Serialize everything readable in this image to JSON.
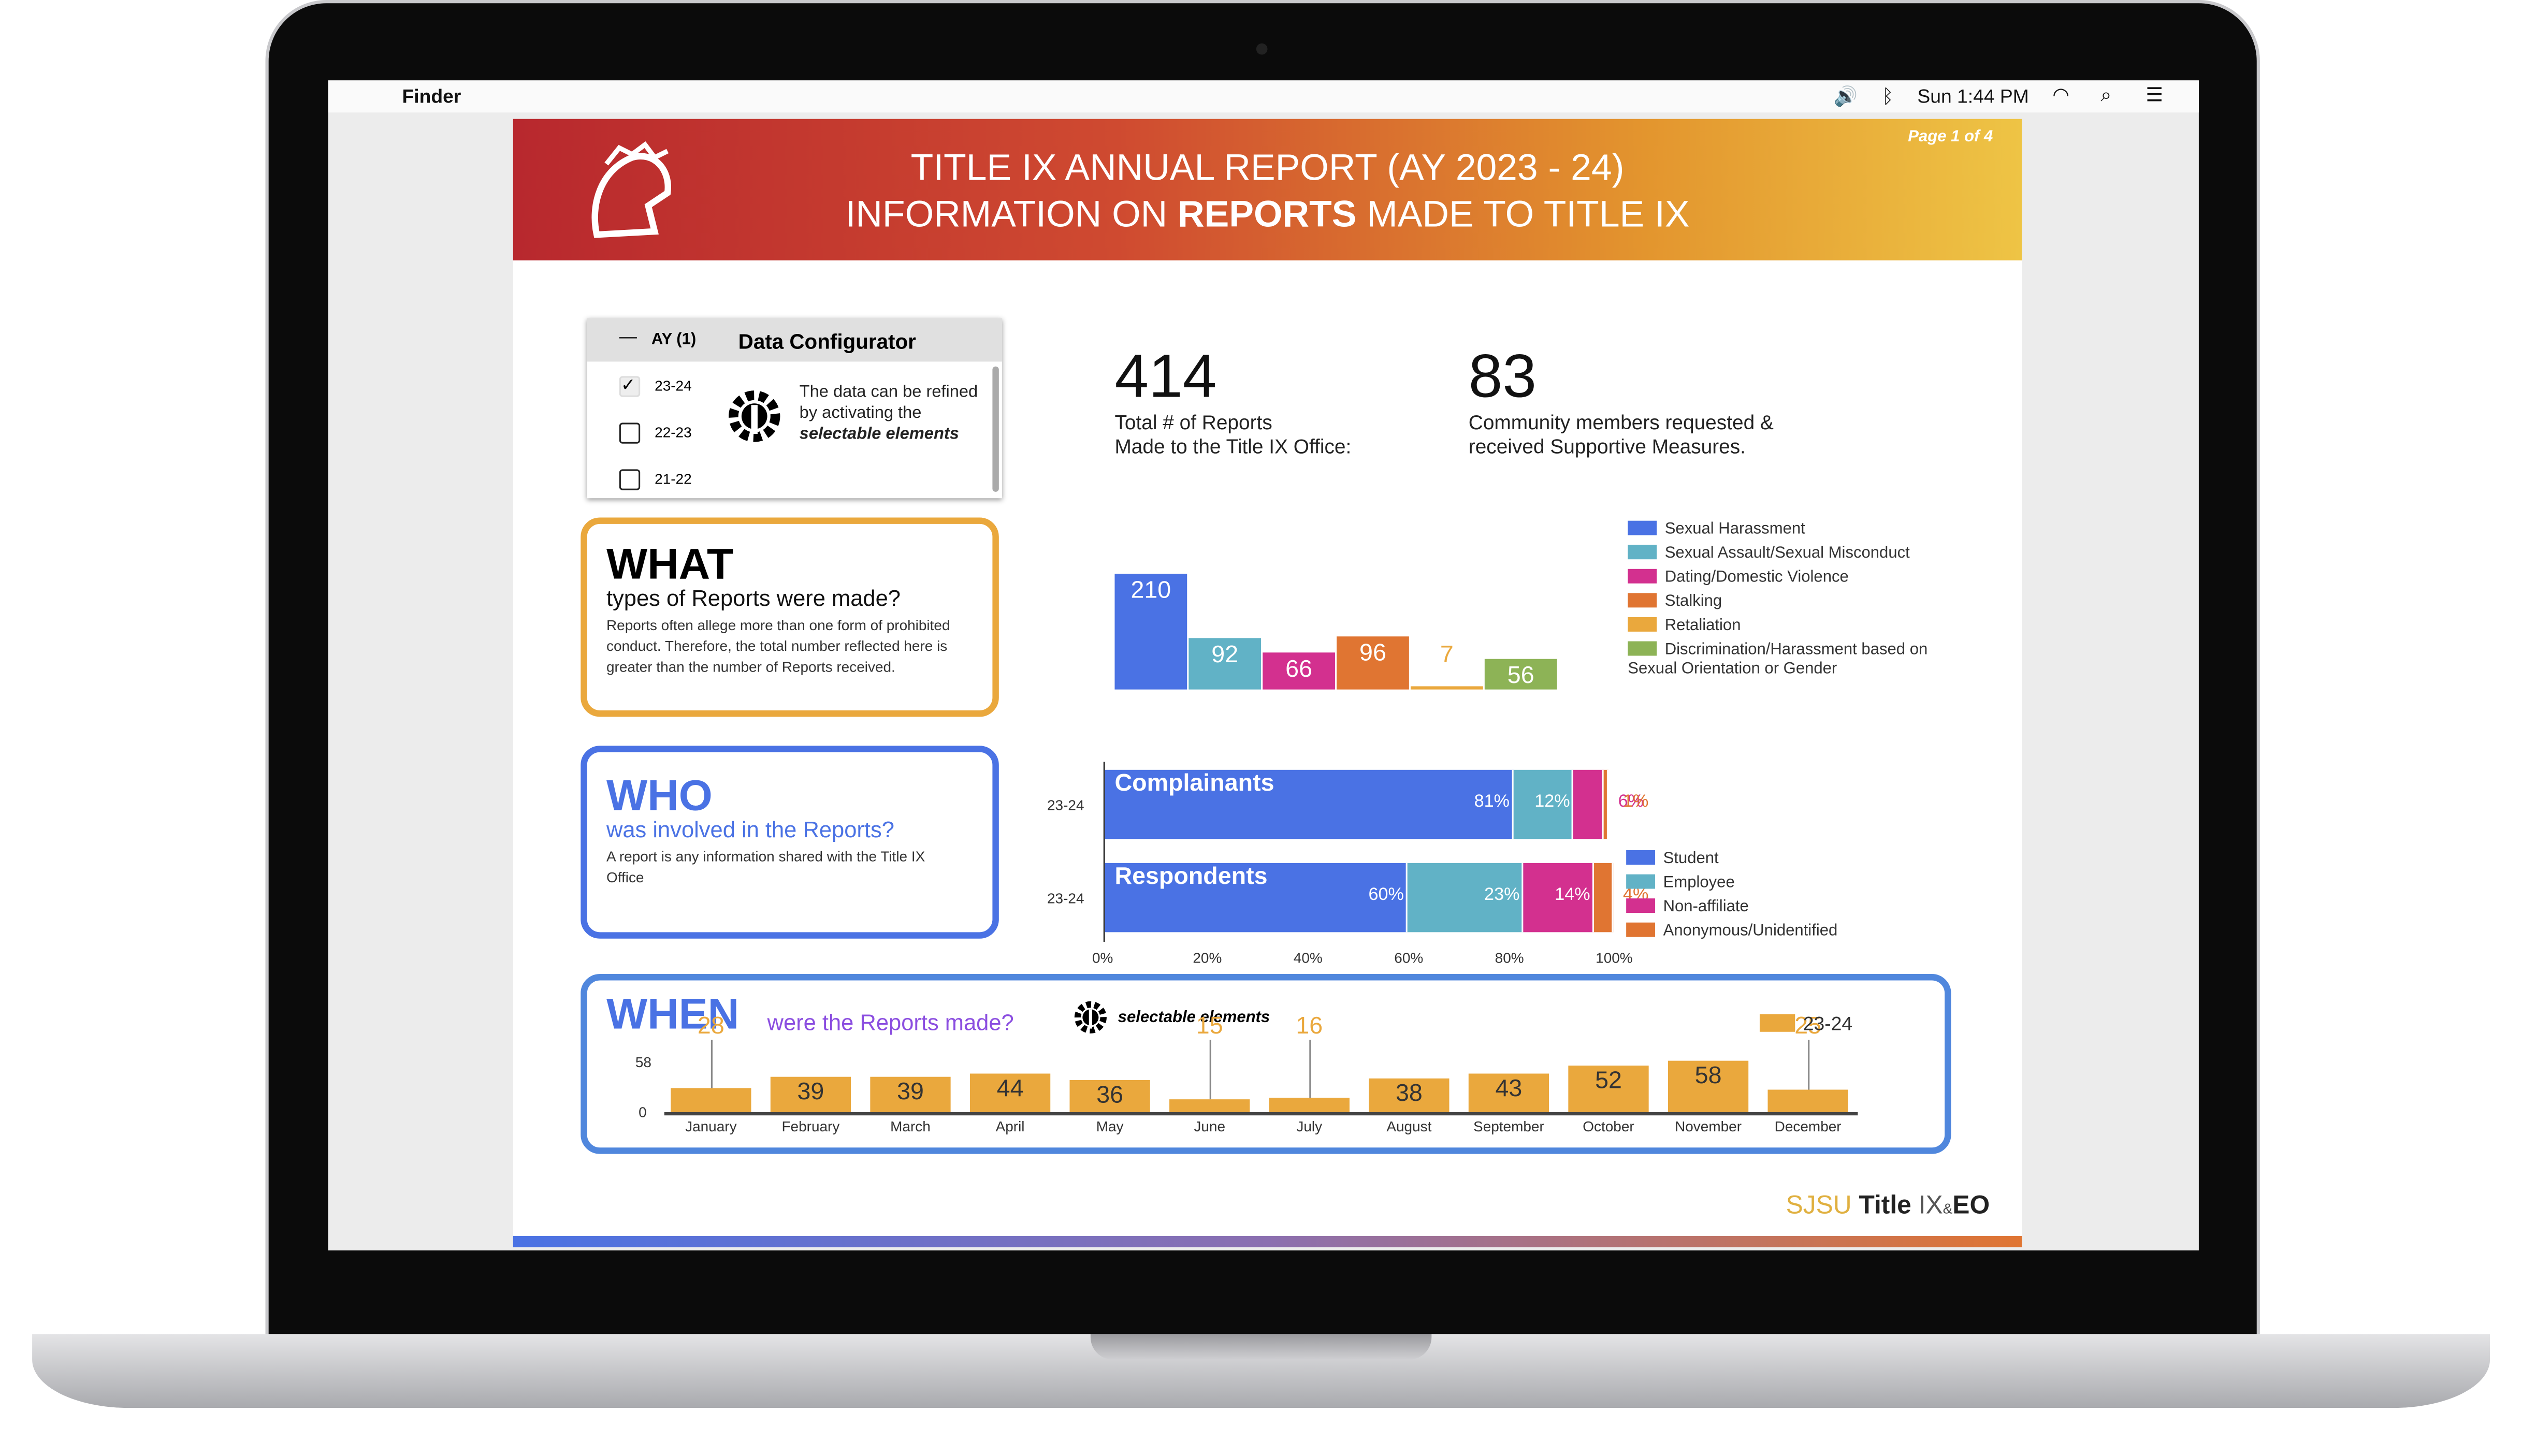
{
  "menubar": {
    "app": "Finder",
    "clock": "Sun 1:44 PM"
  },
  "header": {
    "line1": "TITLE IX ANNUAL REPORT (AY 2023 - 24)",
    "line2_pre": "INFORMATION ON ",
    "line2_bold": "REPORTS",
    "line2_post": " MADE TO TITLE IX",
    "page": "Page 1 of 4"
  },
  "configurator": {
    "group": "AY (1)",
    "title": "Data Configurator",
    "options": [
      {
        "label": "23-24",
        "checked": true
      },
      {
        "label": "22-23",
        "checked": false
      },
      {
        "label": "21-22",
        "checked": false
      }
    ],
    "note_pre": "The data can be refined by activating the ",
    "note_bold": "selectable elements"
  },
  "stats": [
    {
      "value": "414",
      "label1": "Total # of Reports",
      "label2": "Made to the Title IX Office:"
    },
    {
      "value": "83",
      "label1": "Community members requested &",
      "label2": "received Supportive Measures."
    }
  ],
  "what": {
    "title": "WHAT",
    "subtitle": "types of Reports were made?",
    "body": "Reports often allege more than one form of prohibited conduct. Therefore, the total number reflected here is greater than the number of Reports received."
  },
  "who": {
    "title": "WHO",
    "subtitle": "was involved in the Reports?",
    "body": "A report is any information shared with the Title IX Office"
  },
  "when": {
    "title": "WHEN",
    "subtitle": "were the Reports made?",
    "selectable": "selectable elements"
  },
  "footer": {
    "sjsu": "SJSU",
    "title": "Title",
    "ix": "IX",
    "amp": "&",
    "eo": "EO"
  },
  "colors": {
    "blue": "#4a72e4",
    "teal": "#61b2c6",
    "magenta": "#d3308f",
    "orange": "#e07532",
    "gold": "#eaa83d",
    "green": "#8db356"
  },
  "chart_data": [
    {
      "type": "bar",
      "categories": [
        "Sexual Harassment",
        "Sexual Assault/Sexual Misconduct",
        "Dating/Domestic Violence",
        "Stalking",
        "Retaliation",
        "Discrimination/Harassment based on Sexual Orientation or Gender"
      ],
      "values": [
        210,
        92,
        66,
        96,
        7,
        56
      ],
      "colors": [
        "#4a72e4",
        "#61b2c6",
        "#d3308f",
        "#e07532",
        "#eaa83d",
        "#8db356"
      ],
      "legend": "right"
    },
    {
      "type": "bar",
      "orientation": "horizontal",
      "stacked": true,
      "categories": [
        "23-24",
        "23-24"
      ],
      "bar_titles": [
        "Complainants",
        "Respondents"
      ],
      "series": [
        {
          "name": "Student",
          "values": [
            81,
            60
          ],
          "color": "#4a72e4"
        },
        {
          "name": "Employee",
          "values": [
            12,
            23
          ],
          "color": "#61b2c6"
        },
        {
          "name": "Non-affiliate",
          "values": [
            6,
            14
          ],
          "color": "#d3308f"
        },
        {
          "name": "Anonymous/Unidentified",
          "values": [
            1,
            4
          ],
          "color": "#e07532"
        }
      ],
      "xticks": [
        "0%",
        "20%",
        "40%",
        "60%",
        "80%",
        "100%"
      ],
      "xlim": [
        0,
        100
      ],
      "legend": "right"
    },
    {
      "type": "bar",
      "categories": [
        "January",
        "February",
        "March",
        "April",
        "May",
        "June",
        "July",
        "August",
        "September",
        "October",
        "November",
        "December"
      ],
      "series": [
        {
          "name": "23-24",
          "values": [
            28,
            39,
            39,
            44,
            36,
            15,
            16,
            38,
            43,
            52,
            58,
            25
          ],
          "color": "#eaa83d"
        }
      ],
      "yticks": [
        "0",
        "58"
      ],
      "ylim": [
        0,
        58
      ],
      "legend": "top-right"
    }
  ]
}
